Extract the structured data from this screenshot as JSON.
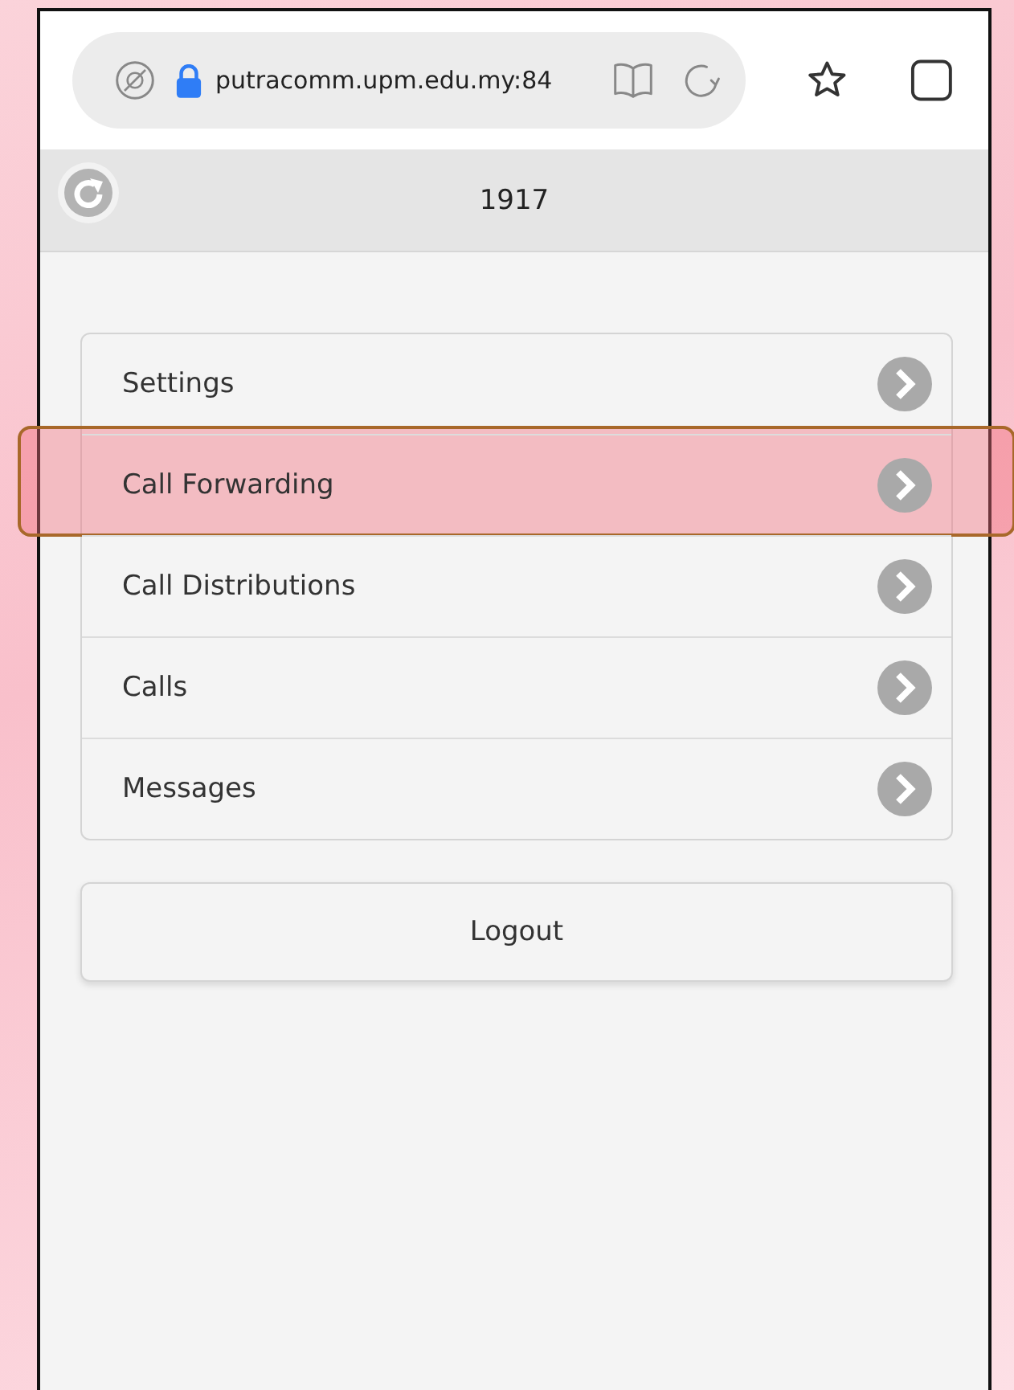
{
  "browser": {
    "url": "putracomm.upm.edu.my:84"
  },
  "header": {
    "title": "1917"
  },
  "menu": [
    {
      "label": "Settings",
      "highlighted": false
    },
    {
      "label": "Call Forwarding",
      "highlighted": true
    },
    {
      "label": "Call Distributions",
      "highlighted": false
    },
    {
      "label": "Calls",
      "highlighted": false
    },
    {
      "label": "Messages",
      "highlighted": false
    }
  ],
  "logout": {
    "label": "Logout"
  }
}
